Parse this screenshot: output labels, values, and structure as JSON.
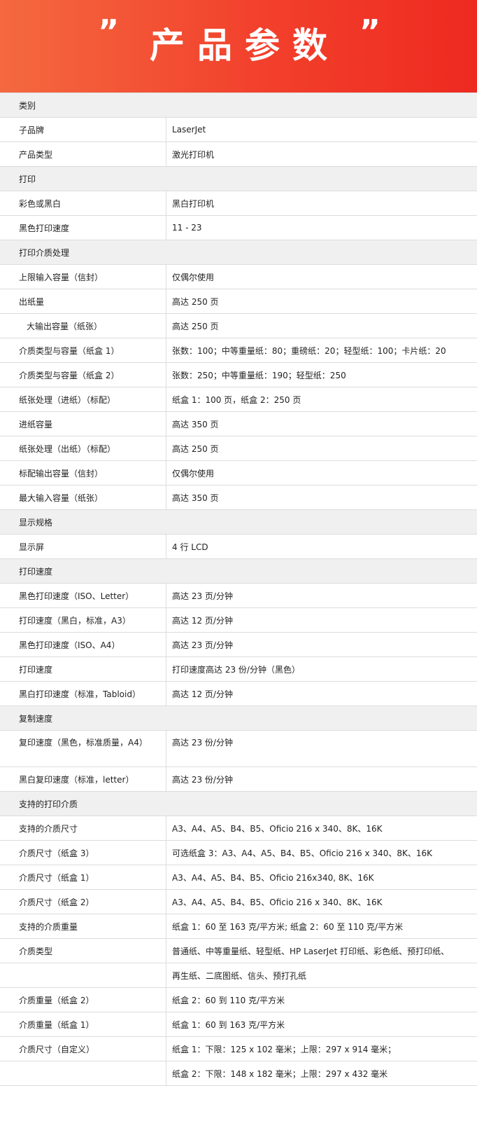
{
  "banner": {
    "title": "产品参数",
    "quote_left": "”",
    "quote_right": "”"
  },
  "rows": [
    {
      "type": "section",
      "label": "类别"
    },
    {
      "type": "item",
      "label": "子品牌",
      "value": "LaserJet"
    },
    {
      "type": "item",
      "label": "产品类型",
      "value": "激光打印机"
    },
    {
      "type": "section",
      "label": "打印"
    },
    {
      "type": "item",
      "label": "彩色或黑白",
      "value": "黑白打印机"
    },
    {
      "type": "item",
      "label": "黑色打印速度",
      "value": "11 - 23"
    },
    {
      "type": "section",
      "label": "打印介质处理"
    },
    {
      "type": "item",
      "label": "上限输入容量（信封）",
      "value": "仅偶尔使用"
    },
    {
      "type": "item",
      "label": "出纸量",
      "value": "高达 250 页"
    },
    {
      "type": "item",
      "label": "大输出容量（纸张）",
      "value": "高达 250 页",
      "indent": true
    },
    {
      "type": "item",
      "label": "介质类型与容量（纸盒 1）",
      "value": "张数：100；中等重量纸：80；重磅纸：20；轻型纸：100；卡片纸：20"
    },
    {
      "type": "item",
      "label": "介质类型与容量（纸盒 2）",
      "value": "张数：250；中等重量纸：190；轻型纸：250"
    },
    {
      "type": "item",
      "label": "纸张处理（进纸）（标配）",
      "value": "纸盒 1：100 页，纸盒 2：250 页"
    },
    {
      "type": "item",
      "label": "进纸容量",
      "value": "高达 350 页"
    },
    {
      "type": "item",
      "label": "纸张处理（出纸）（标配）",
      "value": "高达 250 页"
    },
    {
      "type": "item",
      "label": "标配输出容量（信封）",
      "value": "仅偶尔使用"
    },
    {
      "type": "item",
      "label": "最大输入容量（纸张）",
      "value": "高达 350 页"
    },
    {
      "type": "section",
      "label": "显示规格"
    },
    {
      "type": "item",
      "label": "显示屏",
      "value": "4 行 LCD"
    },
    {
      "type": "section",
      "label": "打印速度"
    },
    {
      "type": "item",
      "label": "黑色打印速度（ISO、Letter）",
      "value": "高达 23 页/分钟"
    },
    {
      "type": "item",
      "label": "打印速度（黑白，标准，A3）",
      "value": "高达 12 页/分钟"
    },
    {
      "type": "item",
      "label": "黑色打印速度（ISO、A4）",
      "value": "高达 23 页/分钟"
    },
    {
      "type": "item",
      "label": "打印速度",
      "value": "打印速度高达 23 份/分钟（黑色）"
    },
    {
      "type": "item",
      "label": "黑白打印速度（标准，Tabloid）",
      "value": "高达 12 页/分钟"
    },
    {
      "type": "section",
      "label": "复制速度"
    },
    {
      "type": "item",
      "label": "复印速度（黑色，标准质量，A4）",
      "value": "高达 23 份/分钟",
      "tall": true
    },
    {
      "type": "item",
      "label": "黑白复印速度（标准，letter）",
      "value": "高达 23 份/分钟"
    },
    {
      "type": "section",
      "label": "支持的打印介质"
    },
    {
      "type": "item",
      "label": "支持的介质尺寸",
      "value": "A3、A4、A5、B4、B5、Oficio 216 x 340、8K、16K"
    },
    {
      "type": "item",
      "label": "介质尺寸（纸盒 3）",
      "value": "可选纸盒 3：A3、A4、A5、B4、B5、Oficio 216 x 340、8K、16K"
    },
    {
      "type": "item",
      "label": "介质尺寸（纸盒 1）",
      "value": "A3、A4、A5、B4、B5、Oficio 216x340, 8K、16K"
    },
    {
      "type": "item",
      "label": "介质尺寸（纸盒 2）",
      "value": "A3、A4、A5、B4、B5、Oficio 216 x 340、8K、16K"
    },
    {
      "type": "item",
      "label": "支持的介质重量",
      "value": "纸盒 1：60 至 163 克/平方米; 纸盒 2：60 至 110 克/平方米"
    },
    {
      "type": "item",
      "label": "介质类型",
      "value": "普通纸、中等重量纸、轻型纸、HP LaserJet 打印纸、彩色纸、预打印纸、"
    },
    {
      "type": "item",
      "label": "",
      "value": "再生纸、二底图纸、信头、预打孔纸"
    },
    {
      "type": "item",
      "label": "介质重量（纸盒 2）",
      "value": "纸盒 2：60 到 110 克/平方米"
    },
    {
      "type": "item",
      "label": "介质重量（纸盒 1）",
      "value": "纸盒 1：60 到 163 克/平方米"
    },
    {
      "type": "item",
      "label": "介质尺寸（自定义）",
      "value": "纸盒 1：下限：125 x 102 毫米；上限：297 x 914 毫米；"
    },
    {
      "type": "item",
      "label": "",
      "value": "纸盒 2：下限：148 x 182 毫米；上限：297 x 432 毫米"
    }
  ]
}
